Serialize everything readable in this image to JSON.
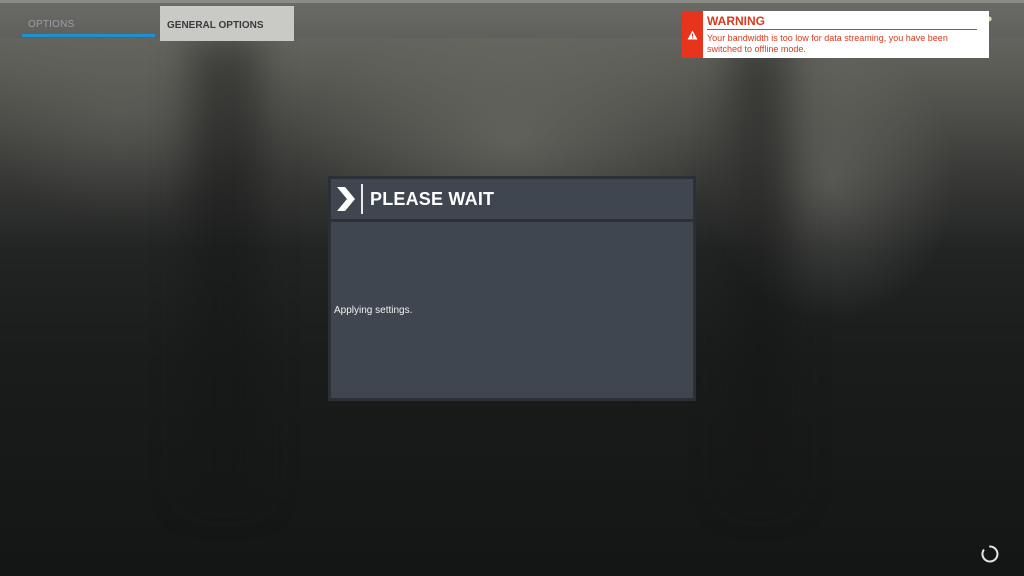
{
  "tabs": {
    "options_label": "OPTIONS",
    "general_label": "GENERAL OPTIONS"
  },
  "warning": {
    "title": "WARNING",
    "message": "Your bandwidth is too low for data streaming, you have been switched to offline mode.",
    "accent_color": "#e8341c"
  },
  "dialog": {
    "title": "PLEASE WAIT",
    "message": "Applying settings."
  },
  "icons": {
    "warning": "warning-triangle-icon",
    "chevron": "chevron-right-icon",
    "spinner": "loading-spinner-icon",
    "top_right": "profile-icon"
  },
  "colors": {
    "tab_underline": "#1e8fcf",
    "dialog_panel": "#3f4650"
  }
}
